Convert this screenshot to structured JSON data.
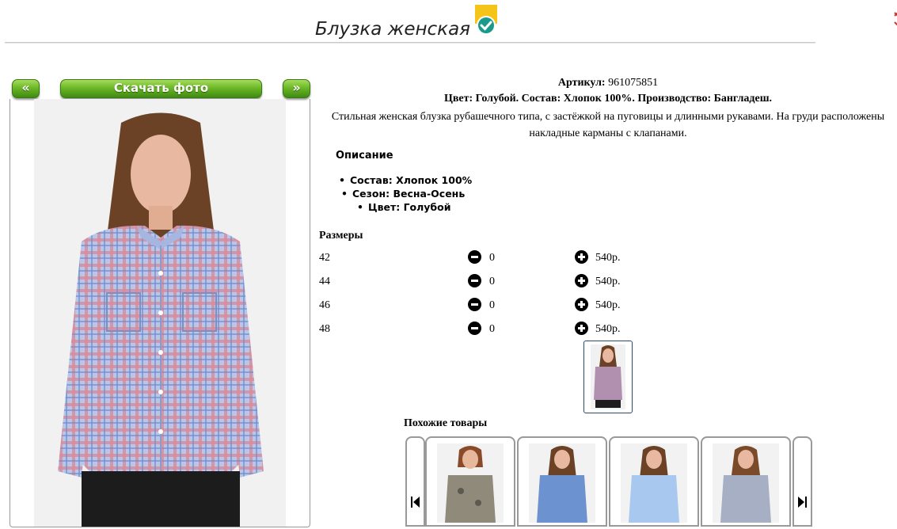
{
  "header": {
    "title": "Блузка женская"
  },
  "gallery": {
    "prev_label": "«",
    "download_label": "Скачать фото",
    "next_label": "»"
  },
  "product": {
    "sku_label": "Артикул:",
    "sku_value": "961075851",
    "meta": "Цвет: Голубой. Состав: Хлопок 100%. Производство: Бангладеш.",
    "description": "Стильная женская блузка рубашечного типа, с застёжкой на пуговицы и длинными рукавами. На груди расположены накладные карманы с клапанами.",
    "description_heading": "Описание",
    "features": [
      "Состав: Хлопок 100%",
      "Сезон: Весна-Осень",
      "Цвет: Голубой"
    ]
  },
  "sizes": {
    "heading": "Размеры",
    "rows": [
      {
        "size": "42",
        "qty": "0",
        "price": "540р."
      },
      {
        "size": "44",
        "qty": "0",
        "price": "540р."
      },
      {
        "size": "46",
        "qty": "0",
        "price": "540р."
      },
      {
        "size": "48",
        "qty": "0",
        "price": "540р."
      }
    ]
  },
  "similar": {
    "heading": "Похожие товары"
  },
  "colors": {
    "button_green": "#6cb826",
    "badge_yellow": "#f5c418",
    "badge_teal": "#1a9a8a"
  }
}
